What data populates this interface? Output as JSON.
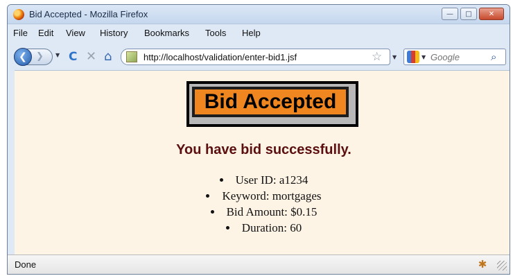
{
  "window": {
    "title": "Bid Accepted - Mozilla Firefox",
    "buttons": {
      "minimize": "—",
      "maximize": "□",
      "close": "✕"
    }
  },
  "menu": [
    {
      "label": "File"
    },
    {
      "label": "Edit"
    },
    {
      "label": "View"
    },
    {
      "label": "History"
    },
    {
      "label": "Bookmarks"
    },
    {
      "label": "Tools"
    },
    {
      "label": "Help"
    }
  ],
  "toolbar": {
    "url": "http://localhost/validation/enter-bid1.jsf",
    "search_placeholder": "Google",
    "icons": {
      "back": "❮",
      "forward": "❯",
      "reload": "C",
      "stop": "✕",
      "home": "⌂",
      "star": "☆",
      "magnifier": "⌕"
    }
  },
  "page": {
    "heading": "Bid Accepted",
    "message": "You have bid successfully.",
    "details": [
      "User ID: a1234",
      "Keyword: mortgages",
      "Bid Amount: $0.15",
      "Duration: 60"
    ]
  },
  "status": {
    "text": "Done"
  }
}
